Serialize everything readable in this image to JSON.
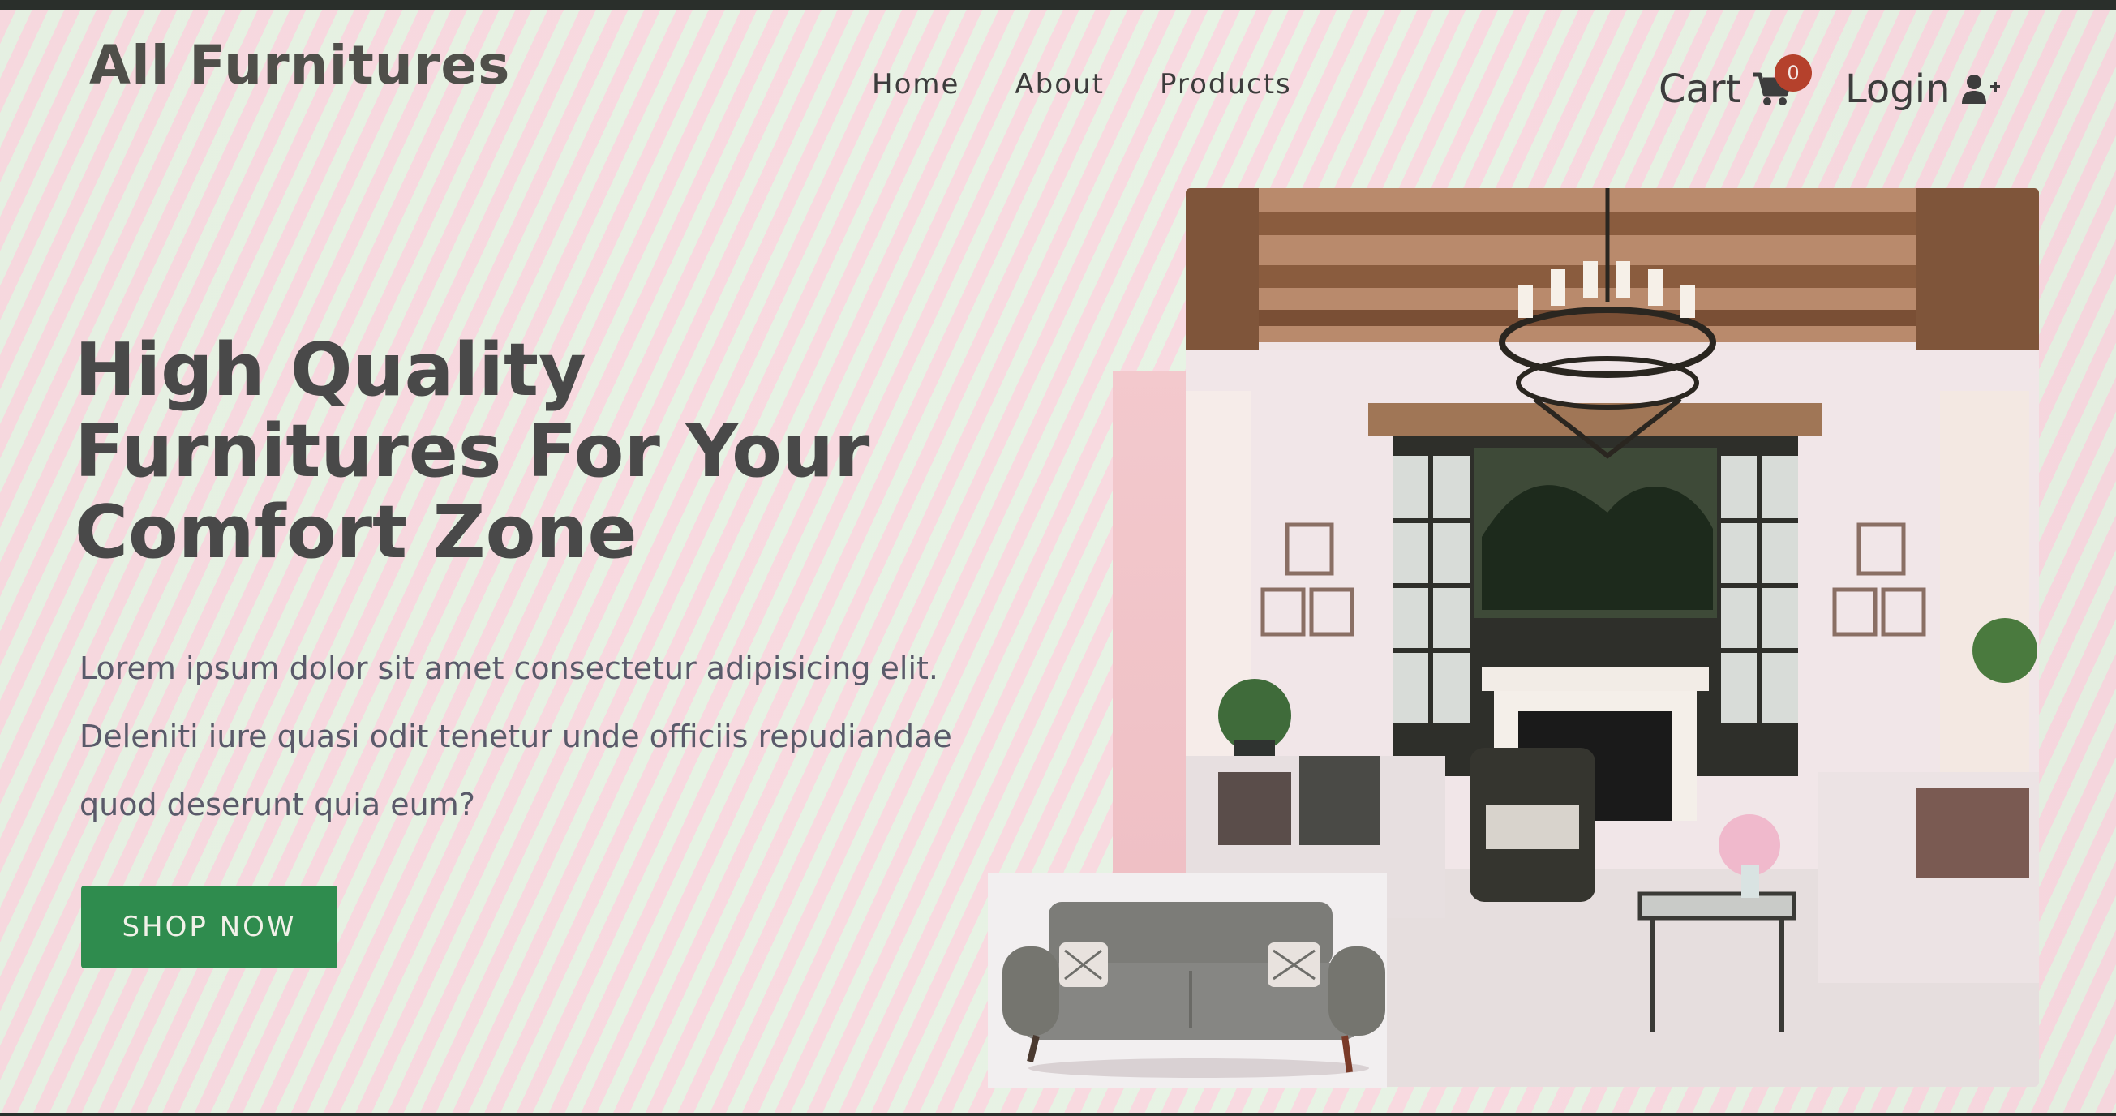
{
  "brand": "All Furnitures",
  "nav": {
    "items": [
      "Home",
      "About",
      "Products"
    ]
  },
  "cart": {
    "label": "Cart",
    "count": "0",
    "icon": "cart-icon"
  },
  "login": {
    "label": "Login",
    "icon": "user-plus-icon"
  },
  "hero": {
    "title_lines": [
      "High Quality",
      "Furnitures For Your",
      "Comfort Zone"
    ],
    "text_lines": [
      "Lorem ipsum dolor sit amet consectetur adipisicing elit.",
      "Deleniti iure quasi odit tenetur unde officiis repudiandae",
      "quod deserunt quia eum?"
    ],
    "cta": "SHOP NOW"
  },
  "colors": {
    "accent": "#2f8c4e",
    "badge": "#b5412c",
    "text": "#494949"
  }
}
